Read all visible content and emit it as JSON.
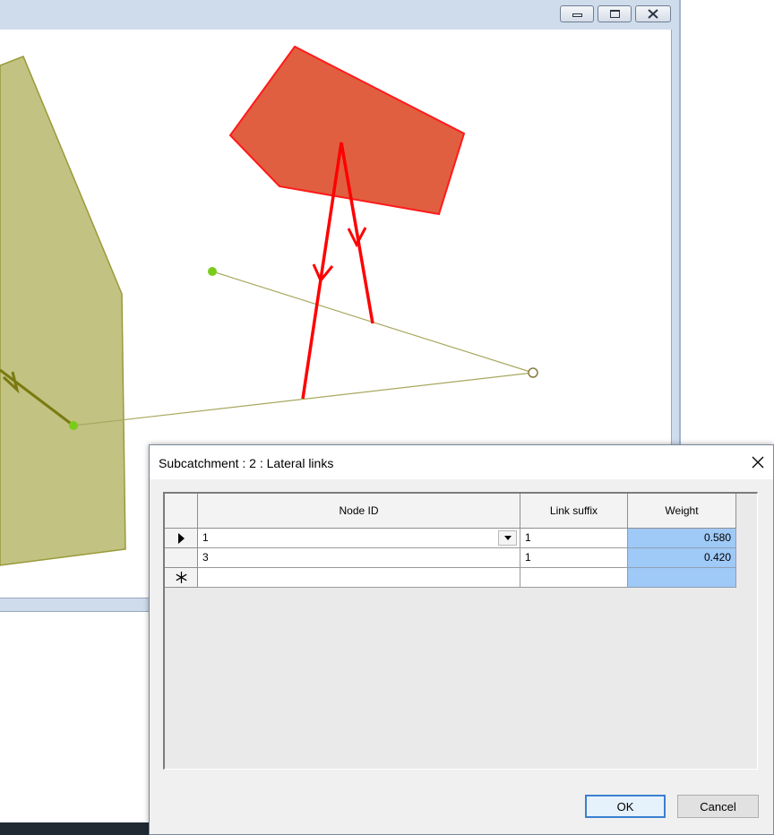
{
  "dialog": {
    "title": "Subcatchment : 2 : Lateral links",
    "columns": {
      "node_id": "Node ID",
      "link_suffix": "Link suffix",
      "weight": "Weight"
    },
    "rows": [
      {
        "node_id": "1",
        "link_suffix": "1",
        "weight": "0.580"
      },
      {
        "node_id": "3",
        "link_suffix": "1",
        "weight": "0.420"
      }
    ],
    "buttons": {
      "ok": "OK",
      "cancel": "Cancel"
    }
  },
  "colors": {
    "subcatchment_selected": "#e05f40",
    "subcatchment_other": "#c2c282",
    "lateral_link_selected": "#ff0000",
    "link_line": "#a8a860",
    "node": "#7acc1a",
    "weight_cell": "#9fc9f6"
  },
  "icons": {
    "minimize": "minimize-icon",
    "maximize": "maximize-icon",
    "close": "close-icon",
    "current_row": "row-pointer-icon",
    "new_row": "new-row-asterisk-icon",
    "dropdown": "chevron-down-icon"
  }
}
